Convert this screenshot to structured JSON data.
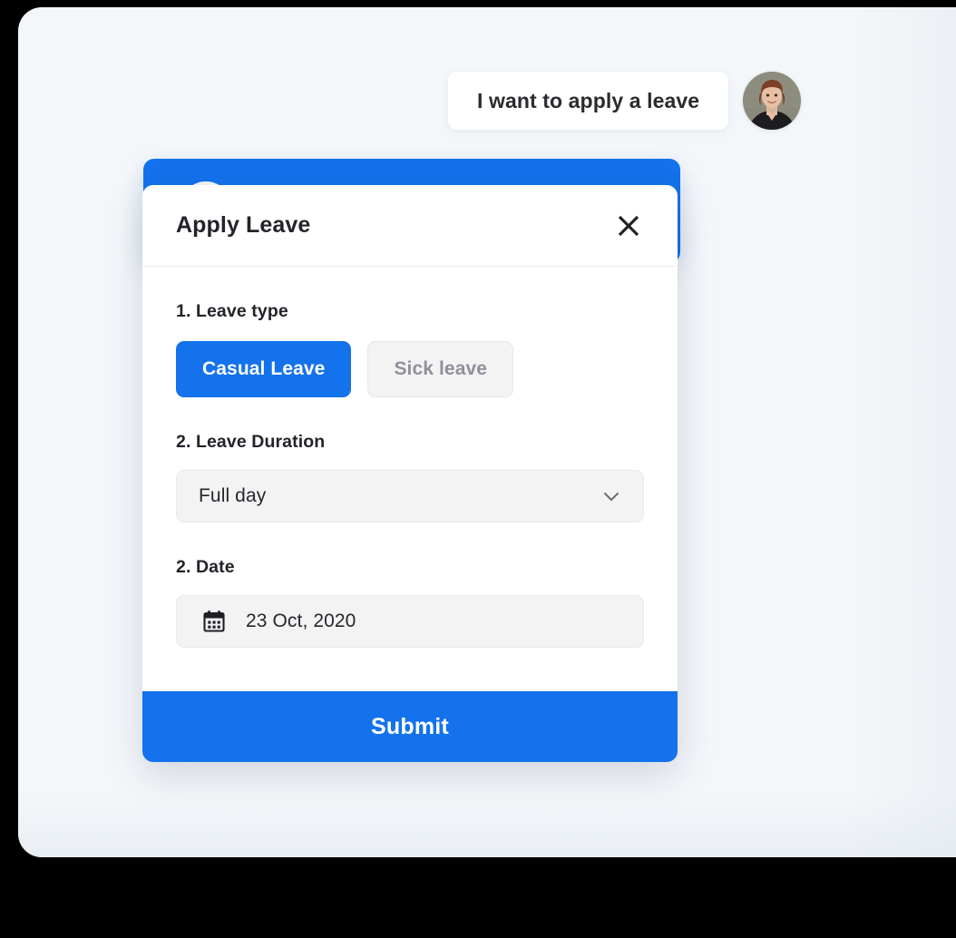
{
  "panel": {
    "background_color": "#f4f7fa"
  },
  "chat": {
    "user_message": "I want to apply a leave",
    "avatar_name": "user-avatar-photo"
  },
  "leave_card": {
    "accent_color": "#1372ec"
  },
  "dialog": {
    "title": "Apply Leave",
    "close_icon": "close-icon",
    "fields": {
      "leave_type": {
        "label": "1. Leave type",
        "options": [
          {
            "label": "Casual Leave",
            "selected": true
          },
          {
            "label": "Sick leave",
            "selected": false
          }
        ]
      },
      "leave_duration": {
        "label": "2. Leave Duration",
        "value": "Full day",
        "chevron_icon": "chevron-down-icon"
      },
      "date": {
        "label": "2. Date",
        "value": "23 Oct, 2020",
        "calendar_icon": "calendar-icon"
      }
    },
    "submit_label": "Submit"
  },
  "colors": {
    "accent_blue": "#1372ec",
    "field_gray": "#f3f3f4",
    "muted_text": "#90909a",
    "text_dark": "#23232a"
  }
}
